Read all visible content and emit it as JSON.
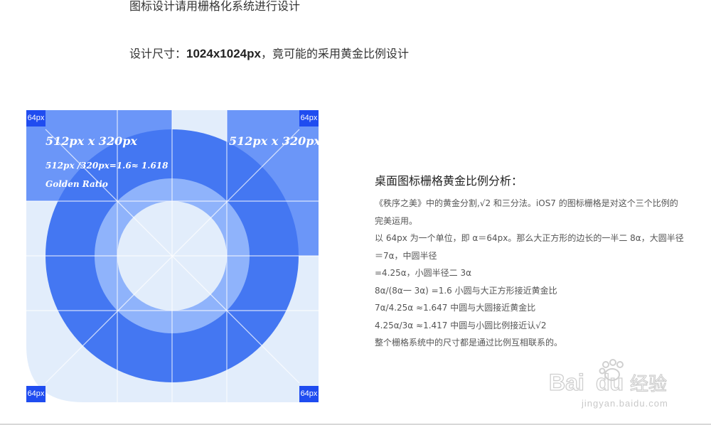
{
  "intro": {
    "line1": "图标设计请用栅格化系统进行设计",
    "line2_prefix": "设计尺寸：",
    "line2_bold": "1024x1024px",
    "line2_suffix": "，竟可能的采用黄金比例设计"
  },
  "figure": {
    "corner_label": "64px",
    "caption_left_title": "512px x 320px",
    "caption_left_formula": "512px /320px=1.6≈ 1.618",
    "caption_left_note": "Golden  Ratio",
    "caption_right_title": "512px x 320px",
    "colors": {
      "background": "#e2edfb",
      "outer_ring": "#4477f2",
      "middle_ring": "#8fb3fb",
      "inner_circle": "#e2edfb",
      "highlight": "#6b96f8",
      "corner": "#1f4cf0",
      "grid": "#ffffff"
    }
  },
  "analysis": {
    "title": "桌面图标栅格黄金比例分析：",
    "lines": [
      "《秩序之美》中的黄金分割,√2 和三分法。iOS7 的图标栅格是对这个三个比例的",
      "完美运用。",
      "以 64px 为一个单位，即 α＝64px。那么大正方形的边长的一半二 8α，大圆半径",
      "＝7α，中圆半径",
      "=4.25α，小圆半径二 3α",
      "8α/(8α一 3α) =1.6 小圆与大正方形接近黄金比",
      "7α/4.25α ≈1.647 中圆与大圆接近黄金比",
      "4.25α/3α ≈1.417 中圆与小圆比例接近认√2",
      "整个栅格系统中的尺寸都是通过比例互相联系的。"
    ]
  },
  "watermark": {
    "brand": "Bai",
    "brand_tail": "du",
    "brand_cn": "经验",
    "url": "jingyan.baidu.com"
  }
}
